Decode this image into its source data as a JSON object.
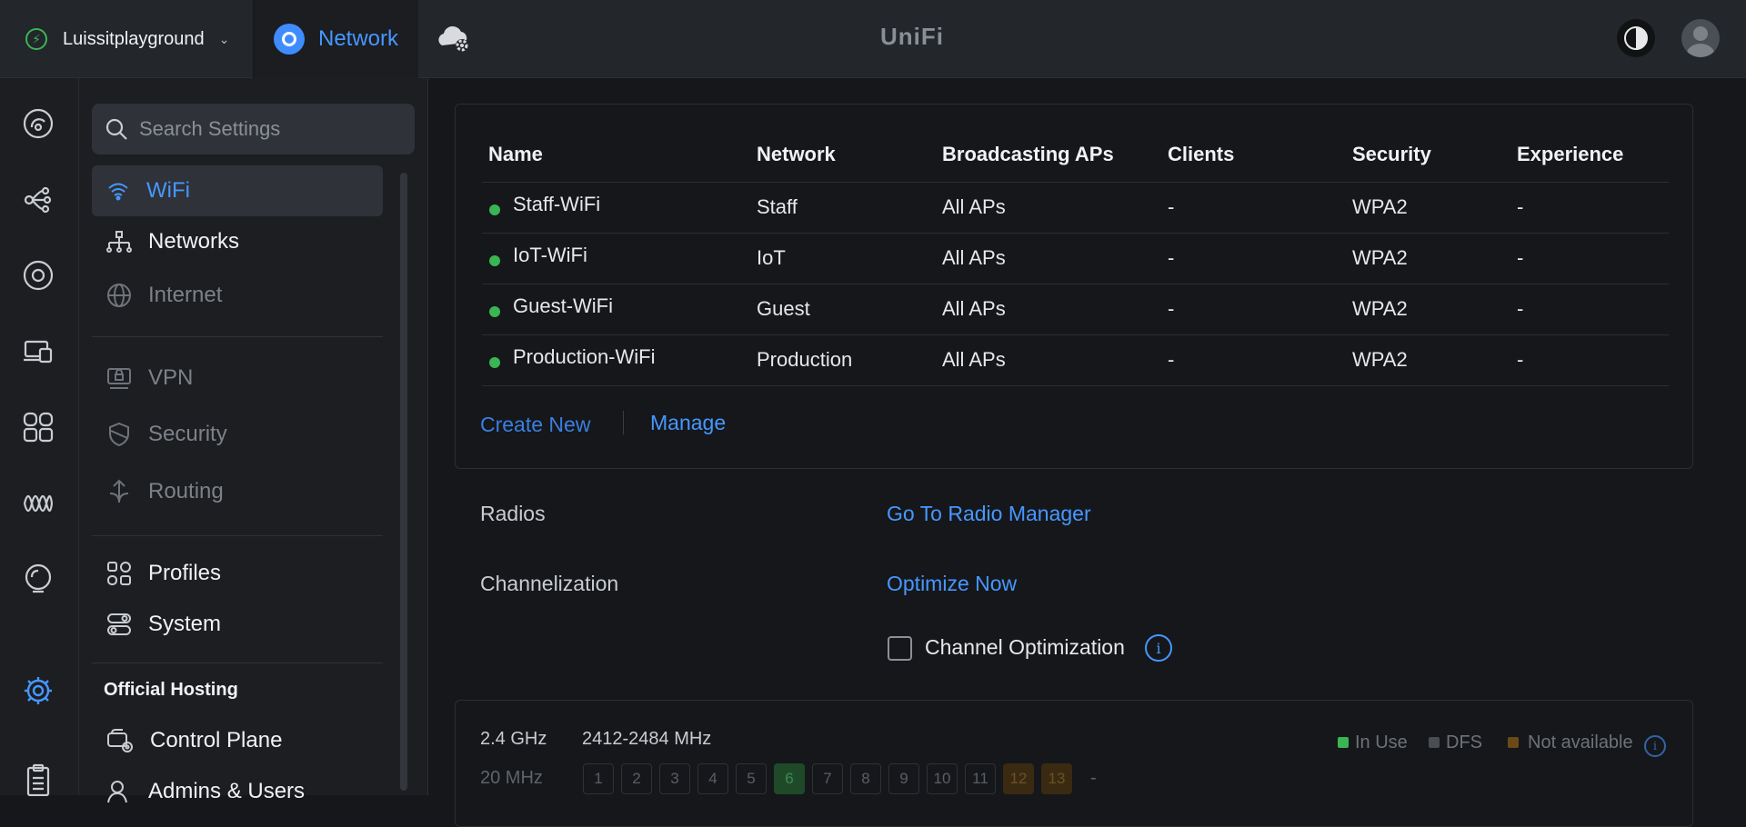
{
  "topbar": {
    "site_name": "Luissitplayground",
    "app_label": "Network",
    "brand": "UniFi"
  },
  "search": {
    "placeholder": "Search Settings"
  },
  "nav": {
    "items": [
      {
        "label": "WiFi",
        "icon": "wifi-icon"
      },
      {
        "label": "Networks",
        "icon": "network-tree-icon"
      },
      {
        "label": "Internet",
        "icon": "globe-icon"
      },
      {
        "label": "VPN",
        "icon": "vpn-icon"
      },
      {
        "label": "Security",
        "icon": "shield-icon"
      },
      {
        "label": "Routing",
        "icon": "routing-icon"
      },
      {
        "label": "Profiles",
        "icon": "profiles-icon"
      },
      {
        "label": "System",
        "icon": "system-toggles-icon"
      }
    ],
    "section_title": "Official Hosting",
    "hosting_items": [
      {
        "label": "Control Plane",
        "icon": "control-plane-icon"
      },
      {
        "label": "Admins & Users",
        "icon": "users-icon"
      }
    ]
  },
  "wifi_table": {
    "columns": [
      "Name",
      "Network",
      "Broadcasting APs",
      "Clients",
      "Security",
      "Experience"
    ],
    "rows": [
      {
        "name": "Staff-WiFi",
        "network": "Staff",
        "aps": "All APs",
        "clients": "-",
        "security": "WPA2",
        "experience": "-"
      },
      {
        "name": "IoT-WiFi",
        "network": "IoT",
        "aps": "All APs",
        "clients": "-",
        "security": "WPA2",
        "experience": "-"
      },
      {
        "name": "Guest-WiFi",
        "network": "Guest",
        "aps": "All APs",
        "clients": "-",
        "security": "WPA2",
        "experience": "-"
      },
      {
        "name": "Production-WiFi",
        "network": "Production",
        "aps": "All APs",
        "clients": "-",
        "security": "WPA2",
        "experience": "-"
      }
    ],
    "create_new": "Create New",
    "manage": "Manage"
  },
  "settings": {
    "radios_label": "Radios",
    "radios_link": "Go To Radio Manager",
    "channelization_label": "Channelization",
    "optimize_link": "Optimize Now",
    "channel_opt_label": "Channel Optimization",
    "info_glyph": "i"
  },
  "radio_panel": {
    "band": "2.4 GHz",
    "range": "2412-2484 MHz",
    "width": "20 MHz",
    "legend": {
      "in_use": "In Use",
      "dfs": "DFS",
      "not_available": "Not available"
    },
    "channels": [
      "1",
      "2",
      "3",
      "4",
      "5",
      "6",
      "7",
      "8",
      "9",
      "10",
      "11",
      "12",
      "13"
    ],
    "channel_active": "6",
    "channels_unavailable": [
      "12",
      "13"
    ],
    "trailing": "-",
    "colors": {
      "in_use": "#3bb454",
      "dfs": "#4a4d52",
      "not_available": "#6b4a16"
    }
  },
  "colors": {
    "accent": "#4797ff",
    "status_green": "#3bb454"
  }
}
